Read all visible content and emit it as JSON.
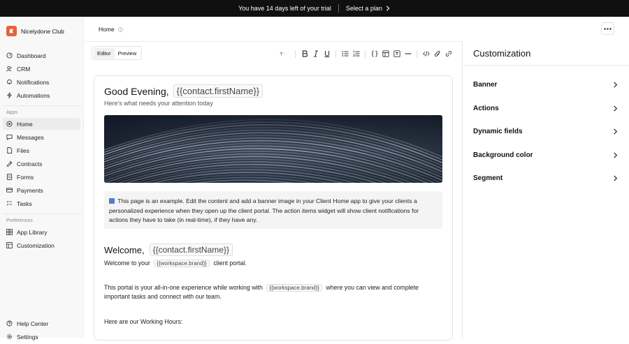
{
  "trial": {
    "message": "You have 14 days left of your trial",
    "cta": "Select a plan"
  },
  "brand": {
    "name": "Nicelydone Club",
    "color": "#e8613c"
  },
  "sidebar": {
    "top_items": [
      {
        "label": "Dashboard",
        "icon": "dashboard-icon"
      },
      {
        "label": "CRM",
        "icon": "users-icon"
      },
      {
        "label": "Notifications",
        "icon": "bell-icon"
      },
      {
        "label": "Automations",
        "icon": "bolt-icon"
      }
    ],
    "apps_label": "Apps",
    "app_items": [
      {
        "label": "Home",
        "icon": "home-icon",
        "active": true
      },
      {
        "label": "Messages",
        "icon": "chat-icon"
      },
      {
        "label": "Files",
        "icon": "file-icon"
      },
      {
        "label": "Contracts",
        "icon": "contract-icon"
      },
      {
        "label": "Forms",
        "icon": "form-icon"
      },
      {
        "label": "Payments",
        "icon": "payment-icon"
      },
      {
        "label": "Tasks",
        "icon": "tasks-icon"
      }
    ],
    "preferences_label": "Preferences",
    "pref_items": [
      {
        "label": "App Library",
        "icon": "library-icon"
      },
      {
        "label": "Customization",
        "icon": "customization-icon"
      }
    ],
    "bottom_items": [
      {
        "label": "Help Center",
        "icon": "help-icon"
      },
      {
        "label": "Settings",
        "icon": "gear-icon"
      }
    ]
  },
  "header": {
    "breadcrumb": "Home"
  },
  "toolbar": {
    "tabs": [
      "Editor",
      "Preview"
    ],
    "active_tab": "Editor"
  },
  "content": {
    "greeting": "Good Evening,",
    "firstname_var": "{{contact.firstName}}",
    "subtitle": "Here's what needs your attention today",
    "callout_text": "This page is an example. Edit the content and add a banner image in your Client Home app to give your clients a personalized experience when they open up the client portal. The action items widget will show client notifications for actions they have to take (in real-time), if they have any.",
    "welcome": "Welcome,",
    "welcome_line_pre": "Welcome to your",
    "workspace_var": "{{workspace.brand}}",
    "welcome_line_post": "client portal.",
    "portal_line_pre": "This portal is your all-in-one experience while working with",
    "portal_line_post": "where you can view and complete",
    "portal_line2": "important tasks and connect with our team.",
    "hours_line": "Here are our Working Hours:"
  },
  "panel": {
    "title": "Customization",
    "items": [
      "Banner",
      "Actions",
      "Dynamic fields",
      "Background color",
      "Segment"
    ]
  }
}
